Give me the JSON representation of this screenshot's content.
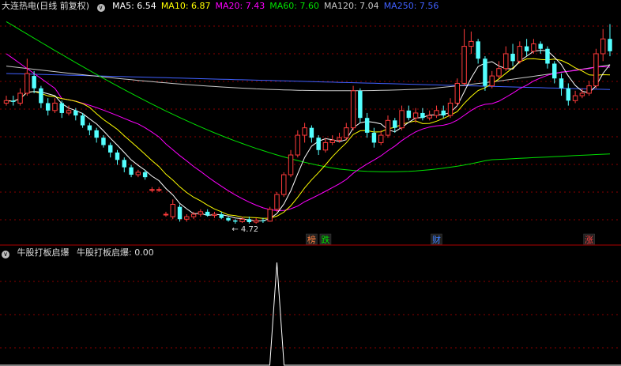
{
  "header": {
    "title": "大连热电(日线 前复权)",
    "ma": [
      {
        "label": "MA5: 6.54",
        "color": "#ffffff"
      },
      {
        "label": "MA10: 6.87",
        "color": "#ffff00"
      },
      {
        "label": "MA20: 7.43",
        "color": "#ff00ff"
      },
      {
        "label": "MA60: 7.60",
        "color": "#00e000"
      },
      {
        "label": "MA120: 7.04",
        "color": "#c8c8c8"
      },
      {
        "label": "MA250: 7.56",
        "color": "#4060ff"
      }
    ]
  },
  "indicator": {
    "name": "牛股打板启爆",
    "value_label": "牛股打板启爆: 0.00",
    "value": 0.0
  },
  "chart_data": [
    {
      "type": "candlestick",
      "series": [
        {
          "name": "MA5",
          "color": "#ffffff"
        },
        {
          "name": "MA10",
          "color": "#ffff00"
        },
        {
          "name": "MA20",
          "color": "#ff00ff"
        },
        {
          "name": "MA60",
          "color": "#00e000"
        },
        {
          "name": "MA120",
          "color": "#c8c8c8"
        },
        {
          "name": "MA250",
          "color": "#4060ff"
        }
      ],
      "annotations": [
        {
          "text": "4.72",
          "note": "low price marker"
        },
        {
          "text": "榜",
          "color": "#ff8040"
        },
        {
          "text": "跌",
          "color": "#00e000"
        },
        {
          "text": "财",
          "color": "#4080ff"
        },
        {
          "text": "涨",
          "color": "#ff4040"
        }
      ],
      "grid": true
    },
    {
      "type": "line",
      "series": [
        {
          "name": "牛股打板启爆",
          "color": "#ffffff"
        }
      ],
      "values_description": "mostly 0 with a single spike",
      "spike_value": 1
    }
  ]
}
